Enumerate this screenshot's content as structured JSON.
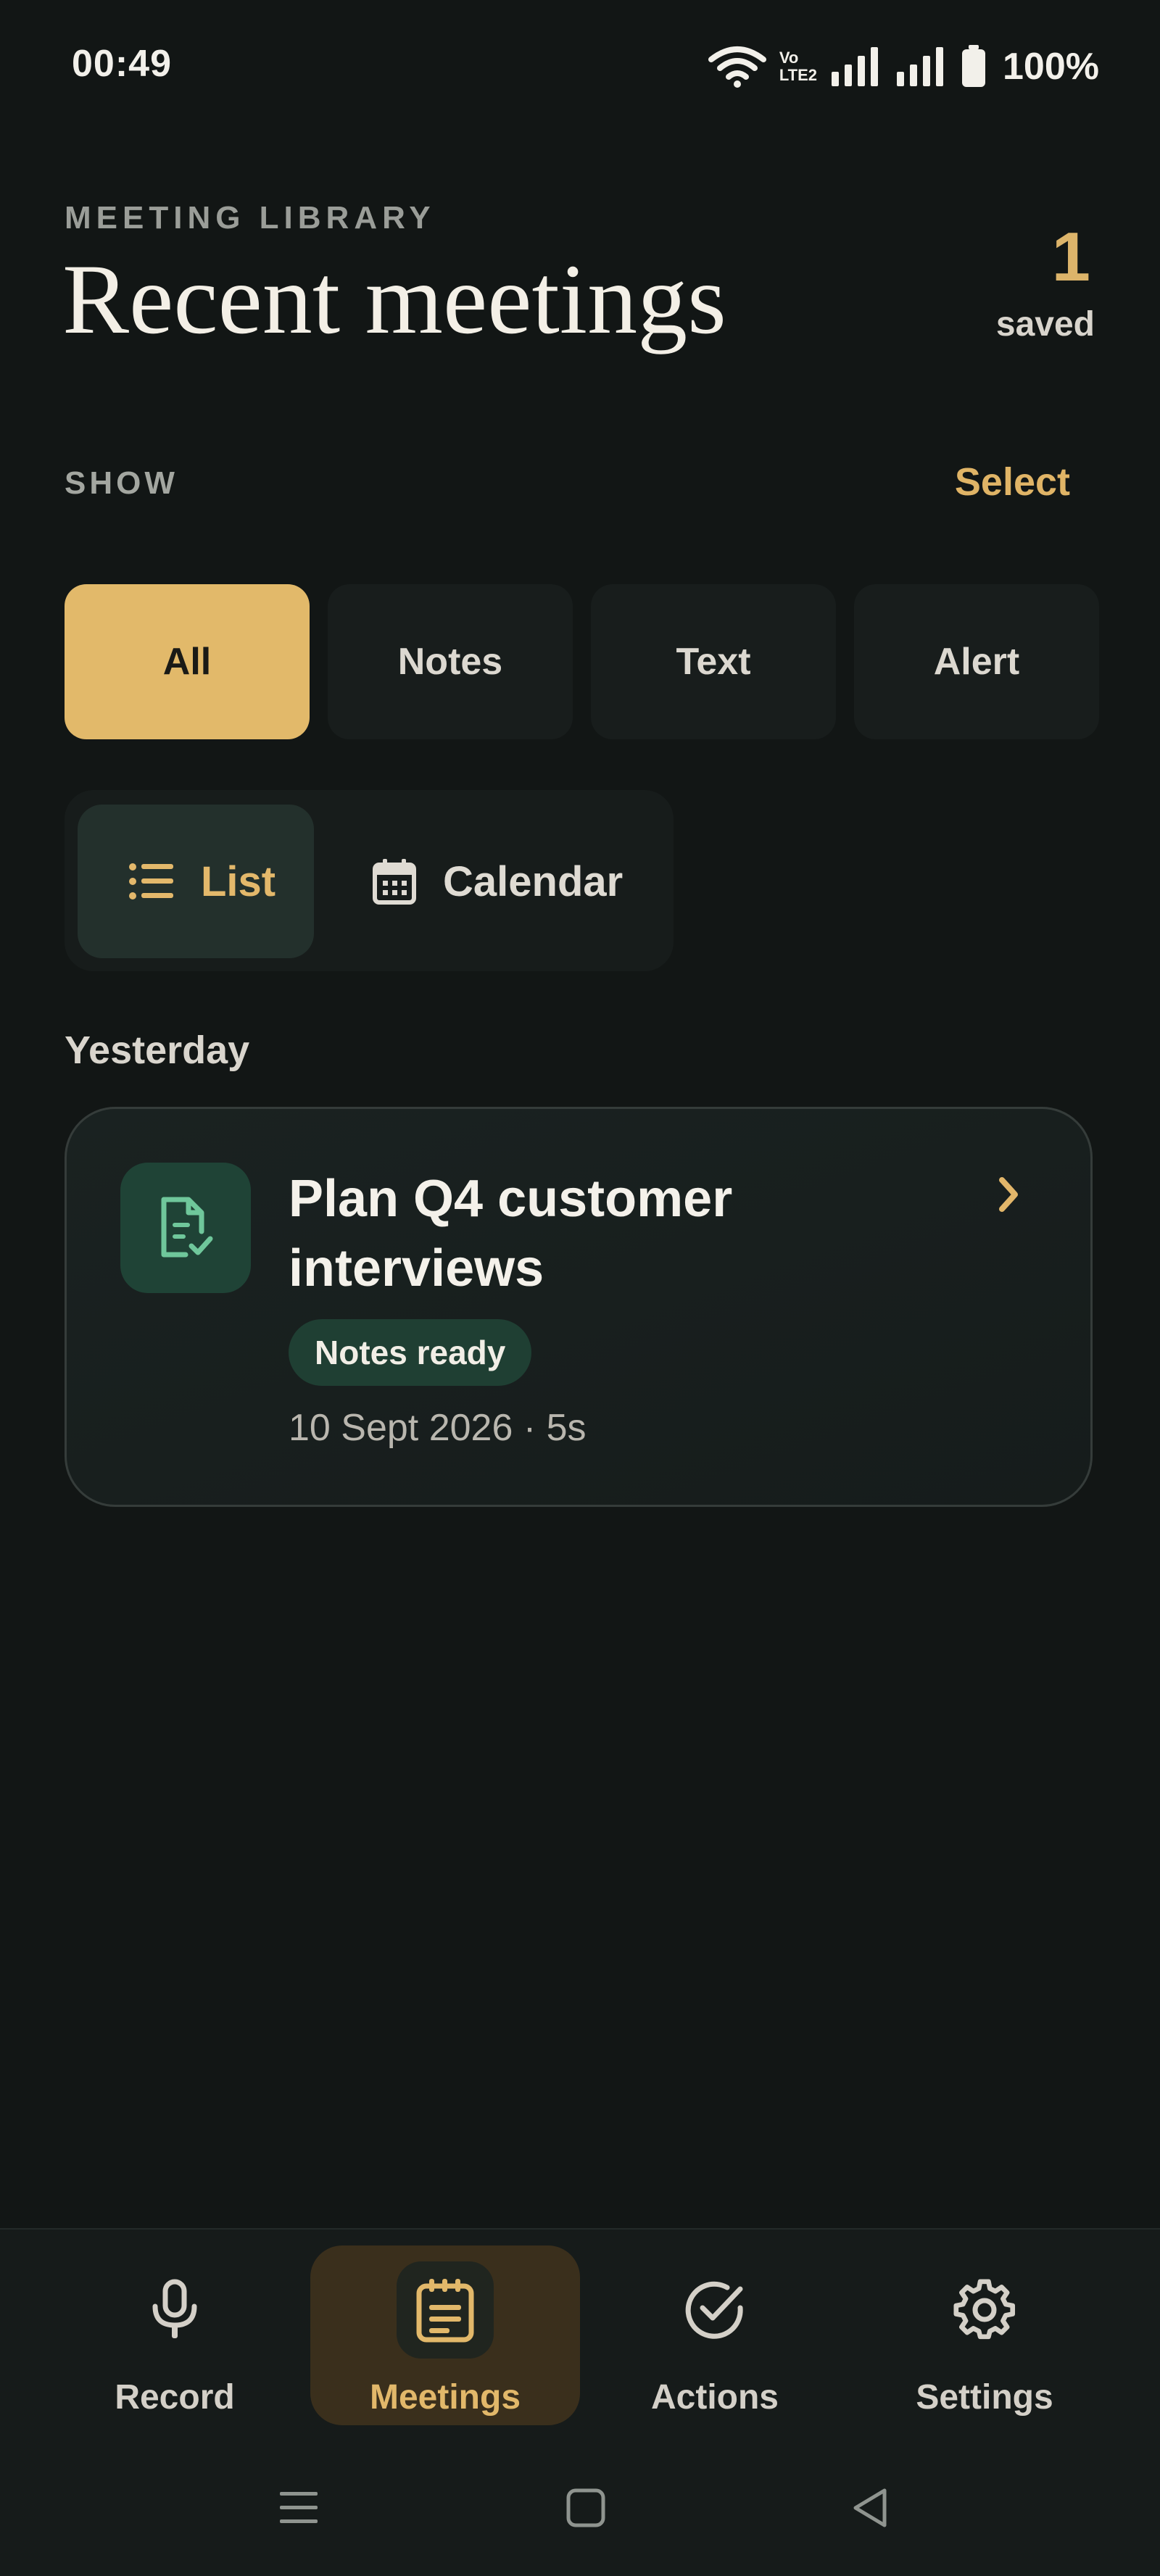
{
  "status_bar": {
    "time": "00:49",
    "network_label_top": "Vo",
    "network_label_bottom": "LTE2",
    "battery": "100%",
    "icons": [
      "wifi-icon",
      "volte-icon",
      "signal-icon",
      "signal-icon",
      "battery-icon"
    ]
  },
  "header": {
    "eyebrow": "MEETING LIBRARY",
    "title": "Recent meetings",
    "saved_count": "1",
    "saved_label": "saved"
  },
  "filters": {
    "show_label": "SHOW",
    "select_label": "Select",
    "chips": [
      {
        "label": "All",
        "active": true
      },
      {
        "label": "Notes",
        "active": false
      },
      {
        "label": "Text",
        "active": false
      },
      {
        "label": "Alert",
        "active": false
      }
    ]
  },
  "view_toggle": {
    "list_label": "List",
    "calendar_label": "Calendar",
    "active": "list"
  },
  "meetings": {
    "section_label": "Yesterday",
    "items": [
      {
        "title": "Plan Q4 customer interviews",
        "badge": "Notes ready",
        "meta": "10 Sept 2026 · 5s",
        "icon": "document-check-icon"
      }
    ]
  },
  "bottom_nav": {
    "items": [
      {
        "label": "Record",
        "icon": "microphone-icon",
        "active": false
      },
      {
        "label": "Meetings",
        "icon": "notepad-icon",
        "active": true
      },
      {
        "label": "Actions",
        "icon": "check-circle-icon",
        "active": false
      },
      {
        "label": "Settings",
        "icon": "gear-icon",
        "active": false
      }
    ]
  },
  "colors": {
    "background": "#121615",
    "accent": "#e2b96a",
    "badge_green": "#1f3f33"
  }
}
